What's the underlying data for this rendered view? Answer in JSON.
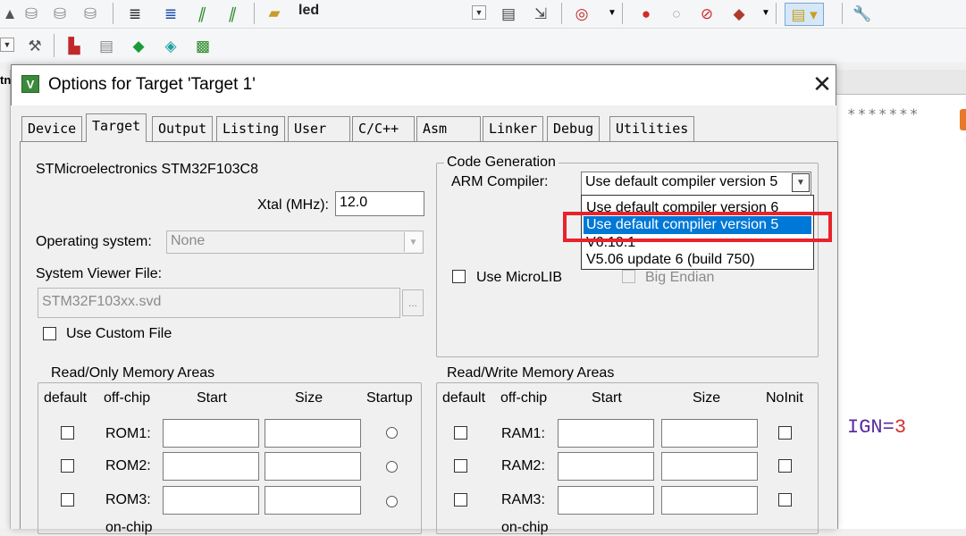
{
  "toolbar": {
    "target_name": "led",
    "row1_icons": [
      "translate-icon",
      "build-icon",
      "rebuild-icon",
      "indent-icon",
      "unindent-icon",
      "comment-icon",
      "uncomment-icon",
      "target-icon"
    ],
    "row2_icons": [
      "options-icon",
      "manage-icon",
      "pack-installer-icon",
      "component-icon",
      "diamond-icon",
      "gem-icon"
    ]
  },
  "editor": {
    "stars": "*******",
    "code_text": "IGN=",
    "code_number": "3",
    "left_tab_fragment": "tn"
  },
  "dialog": {
    "title": "Options for Target 'Target 1'",
    "close_glyph": "✕",
    "app_icon_letter": "V",
    "tabs": [
      "Device",
      "Target",
      "Output",
      "Listing",
      "User",
      "C/C++",
      "Asm",
      "Linker",
      "Debug",
      "Utilities"
    ],
    "active_tab": "Target",
    "device_name": "STMicroelectronics STM32F103C8",
    "xtal_label": "Xtal (MHz):",
    "xtal_value": "12.0",
    "os_label": "Operating system:",
    "os_value": "None",
    "sysviewer_label": "System Viewer File:",
    "sysviewer_value": "STM32F103xx.svd",
    "browse_label": "...",
    "use_custom_file_label": "Use Custom File",
    "code_generation": {
      "title": "Code Generation",
      "arm_compiler_label": "ARM Compiler:",
      "arm_compiler_value": "Use default compiler version 5",
      "dropdown_options": [
        "Use default compiler version 6",
        "Use default compiler version 5",
        "V6.10.1",
        "V5.06 update 6 (build 750)"
      ],
      "selected_option_index": 1,
      "use_microlib_label": "Use MicroLIB",
      "big_endian_label": "Big Endian"
    },
    "ro_memory": {
      "title": "Read/Only Memory Areas",
      "headers": [
        "default",
        "off-chip",
        "Start",
        "Size",
        "Startup"
      ],
      "rows": [
        "ROM1:",
        "ROM2:",
        "ROM3:"
      ],
      "footer": "on-chip"
    },
    "rw_memory": {
      "title": "Read/Write Memory Areas",
      "headers": [
        "default",
        "off-chip",
        "Start",
        "Size",
        "NoInit"
      ],
      "rows": [
        "RAM1:",
        "RAM2:",
        "RAM3:"
      ],
      "footer": "on-chip"
    }
  },
  "colors": {
    "highlight": "#0078d7",
    "annotation_red": "#e8232a"
  }
}
